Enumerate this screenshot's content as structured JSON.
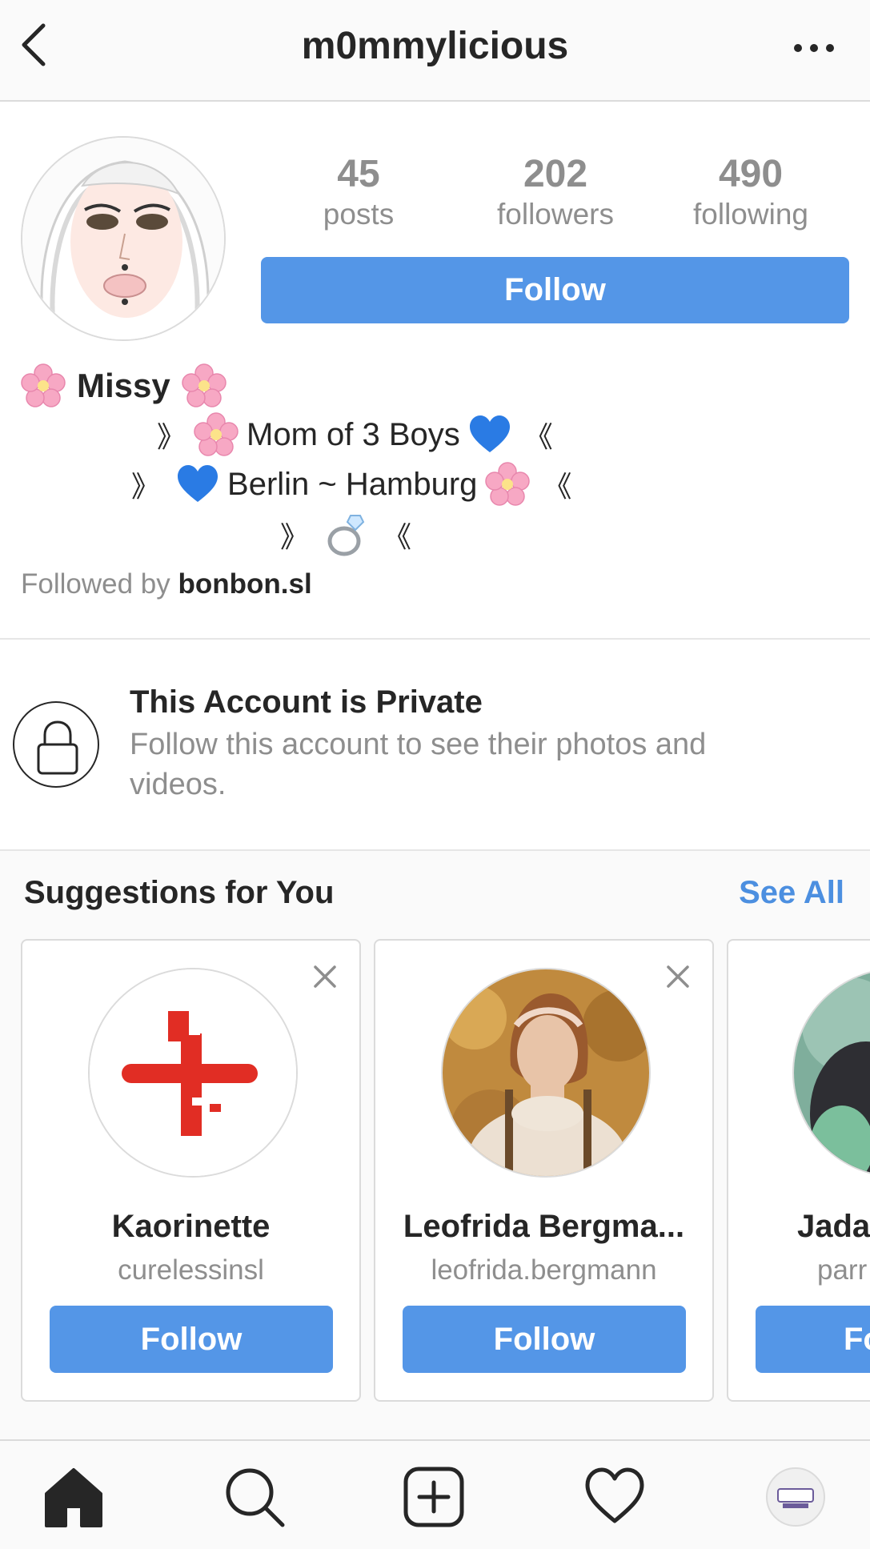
{
  "header": {
    "username": "m0mmylicious",
    "back_icon": "chevron-left-icon",
    "more_icon": "more-horizontal-icon"
  },
  "profile": {
    "stats": [
      {
        "value": "45",
        "label": "posts"
      },
      {
        "value": "202",
        "label": "followers"
      },
      {
        "value": "490",
        "label": "following"
      }
    ],
    "follow_label": "Follow",
    "name": "Missy",
    "bio": {
      "line1": "Mom of 3 Boys",
      "line2": "Berlin ~ Hamburg",
      "open_bracket": "》",
      "close_bracket": "《"
    },
    "followed_by_prefix": "Followed by ",
    "followed_by_user": "bonbon.sl"
  },
  "private": {
    "title": "This Account is Private",
    "subtitle": "Follow this account to see their photos and videos."
  },
  "suggestions": {
    "title": "Suggestions for You",
    "see_all": "See All",
    "cards": [
      {
        "name": "Kaorinette",
        "handle": "curelessinsl",
        "follow": "Follow"
      },
      {
        "name": "Leofrida Bergma...",
        "handle": "leofrida.bergmann",
        "follow": "Follow"
      },
      {
        "name": "Jada",
        "handle": "parr",
        "follow": "Fo"
      }
    ]
  },
  "colors": {
    "accent": "#5496e7",
    "link": "#4c8fe0",
    "text": "#262626",
    "muted": "#8e8e8e"
  },
  "tabbar": {
    "icons": [
      "home-icon",
      "search-icon",
      "new-post-icon",
      "activity-heart-icon",
      "profile-avatar"
    ]
  }
}
